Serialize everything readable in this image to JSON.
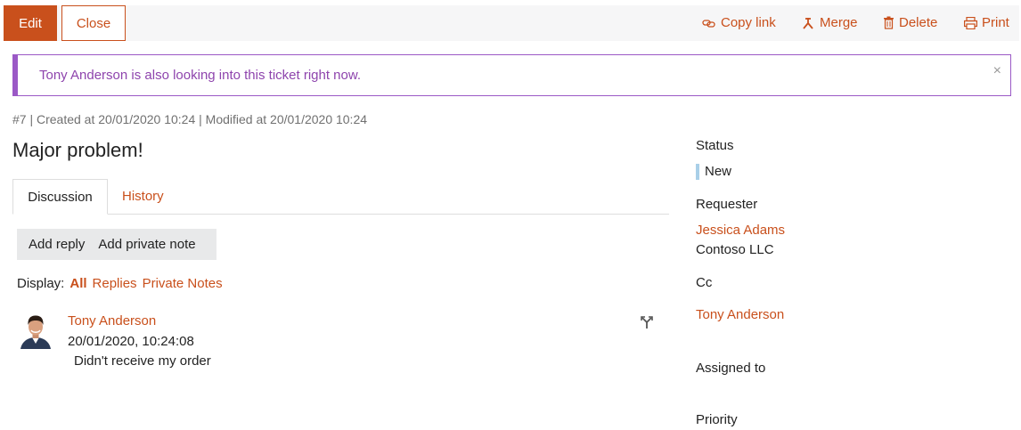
{
  "toolbar": {
    "edit_label": "Edit",
    "close_label": "Close",
    "copy_link_label": "Copy link",
    "merge_label": "Merge",
    "delete_label": "Delete",
    "print_label": "Print"
  },
  "alert": {
    "text": "Tony Anderson is also looking into this ticket right now.",
    "close_glyph": "×"
  },
  "ticket": {
    "meta": "#7 | Created at 20/01/2020 10:24 | Modified at 20/01/2020 10:24",
    "title": "Major problem!"
  },
  "tabs": [
    {
      "label": "Discussion",
      "active": true
    },
    {
      "label": "History",
      "active": false
    }
  ],
  "actions": {
    "add_reply": "Add reply",
    "add_private_note": "Add private note"
  },
  "display": {
    "label": "Display:",
    "options": [
      "All",
      "Replies",
      "Private Notes"
    ],
    "selected": "All"
  },
  "message": {
    "author": "Tony Anderson",
    "timestamp": "20/01/2020, 10:24:08",
    "body": "Didn't receive my order"
  },
  "sidebar": {
    "status_label": "Status",
    "status_value": "New",
    "requester_label": "Requester",
    "requester_name": "Jessica Adams",
    "requester_company": "Contoso LLC",
    "cc_label": "Cc",
    "cc_name": "Tony Anderson",
    "assigned_label": "Assigned to",
    "priority_label": "Priority"
  },
  "colors": {
    "accent": "#c9501c",
    "alert": "#8e44ad",
    "status_new": "#a9cfe8"
  },
  "icons": {
    "copy_link": "link-icon",
    "merge": "merge-icon",
    "delete": "trash-icon",
    "print": "print-icon",
    "message_action": "split-icon"
  }
}
